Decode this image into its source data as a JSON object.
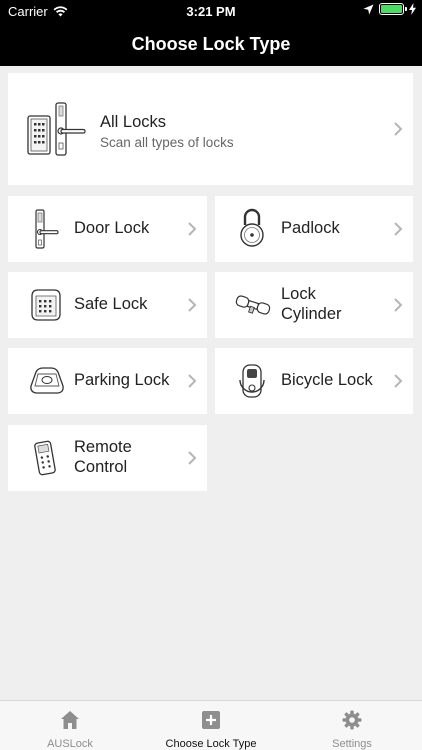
{
  "status_bar": {
    "carrier": "Carrier",
    "time": "3:21 PM"
  },
  "nav": {
    "title": "Choose Lock Type"
  },
  "all_locks": {
    "title": "All Locks",
    "subtitle": "Scan all types of locks"
  },
  "lock_types": [
    {
      "label": "Door Lock",
      "icon": "door-lock-icon"
    },
    {
      "label": "Padlock",
      "icon": "padlock-icon"
    },
    {
      "label": "Safe Lock",
      "icon": "safe-lock-icon"
    },
    {
      "label": "Lock\nCylinder",
      "icon": "lock-cylinder-icon"
    },
    {
      "label": "Parking Lock",
      "icon": "parking-lock-icon"
    },
    {
      "label": "Bicycle Lock",
      "icon": "bicycle-lock-icon"
    },
    {
      "label": "Remote\nControl",
      "icon": "remote-control-icon"
    }
  ],
  "tabs": [
    {
      "label": "AUSLock",
      "icon": "home-icon",
      "active": false
    },
    {
      "label": "Choose Lock Type",
      "icon": "add-square-icon",
      "active": true
    },
    {
      "label": "Settings",
      "icon": "gear-icon",
      "active": false
    }
  ],
  "colors": {
    "nav_background": "#000000",
    "page_background": "#efefef",
    "battery": "#4cd964",
    "tab_inactive": "#8e8e8e"
  }
}
